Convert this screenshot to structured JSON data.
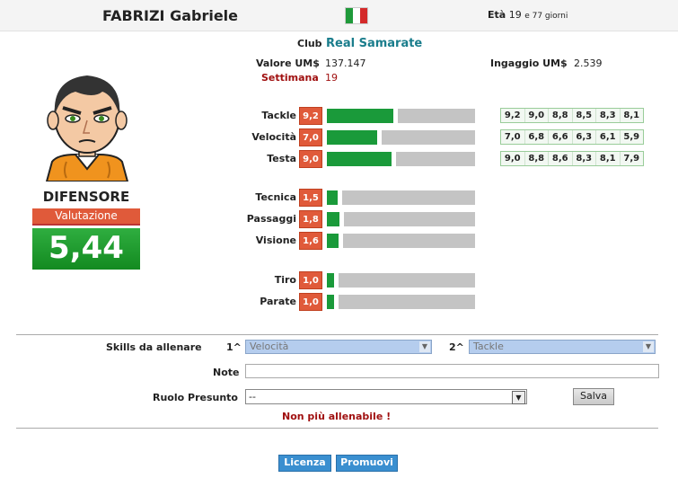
{
  "player": {
    "name": "FABRIZI Gabriele",
    "age_label": "Età",
    "age_years": "19",
    "age_rest": "e 77 giorni"
  },
  "colors": {
    "flag": [
      "#1f9a3a",
      "#ffffff",
      "#d42a2a"
    ]
  },
  "club": {
    "label": "Club",
    "name": "Real Samarate"
  },
  "valore": {
    "label": "Valore UM$",
    "value": "137.147"
  },
  "ingaggio": {
    "label": "Ingaggio UM$",
    "value": "2.539"
  },
  "settimana": {
    "label": "Settimana",
    "value": "19"
  },
  "role": "DIFENSORE",
  "valutazione": {
    "label": "Valutazione",
    "value": "5,44"
  },
  "skills": [
    {
      "label": "Tackle",
      "value": "9,2",
      "level": 9.2,
      "history": [
        "9,2",
        "9,0",
        "8,8",
        "8,5",
        "8,3",
        "8,1"
      ]
    },
    {
      "label": "Velocità",
      "value": "7,0",
      "level": 7.0,
      "history": [
        "7,0",
        "6,8",
        "6,6",
        "6,3",
        "6,1",
        "5,9"
      ]
    },
    {
      "label": "Testa",
      "value": "9,0",
      "level": 9.0,
      "history": [
        "9,0",
        "8,8",
        "8,6",
        "8,3",
        "8,1",
        "7,9"
      ]
    },
    {
      "label": "Tecnica",
      "value": "1,5",
      "level": 1.5,
      "history": []
    },
    {
      "label": "Passaggi",
      "value": "1,8",
      "level": 1.8,
      "history": []
    },
    {
      "label": "Visione",
      "value": "1,6",
      "level": 1.6,
      "history": []
    },
    {
      "label": "Tiro",
      "value": "1,0",
      "level": 1.0,
      "history": []
    },
    {
      "label": "Parate",
      "value": "1,0",
      "level": 1.0,
      "history": []
    }
  ],
  "training": {
    "label": "Skills da allenare",
    "first_label": "1^",
    "first_value": "Velocità",
    "second_label": "2^",
    "second_value": "Tackle",
    "note_label": "Note",
    "note_value": "",
    "ruolo_label": "Ruolo Presunto",
    "ruolo_value": "--",
    "save_label": "Salva",
    "warning": "Non più allenabile !"
  },
  "actions": {
    "licenza": "Licenza",
    "promuovi": "Promuovi"
  }
}
